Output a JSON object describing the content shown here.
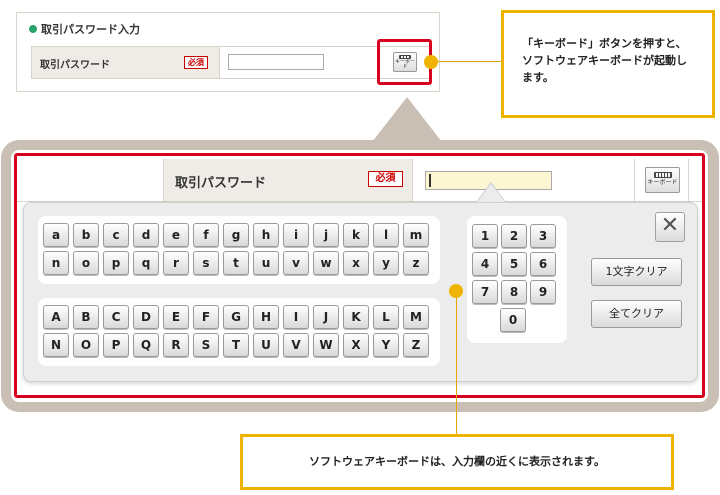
{
  "top_form": {
    "section_title": "取引パスワード入力",
    "field_label": "取引パスワード",
    "required_badge": "必須",
    "keyboard_button_label": "キーボード"
  },
  "callouts": {
    "top": "「キーボード」ボタンを押すと、ソフトウェアキーボードが起動します。",
    "bottom": "ソフトウェアキーボードは、入力欄の近くに表示されます。"
  },
  "enlarged_form": {
    "field_label": "取引パスワード",
    "required_badge": "必須",
    "keyboard_button_label": "キーボード"
  },
  "software_keyboard": {
    "lowercase_keys": [
      "a",
      "b",
      "c",
      "d",
      "e",
      "f",
      "g",
      "h",
      "i",
      "j",
      "k",
      "l",
      "m",
      "n",
      "o",
      "p",
      "q",
      "r",
      "s",
      "t",
      "u",
      "v",
      "w",
      "x",
      "y",
      "z"
    ],
    "uppercase_keys": [
      "A",
      "B",
      "C",
      "D",
      "E",
      "F",
      "G",
      "H",
      "I",
      "J",
      "K",
      "L",
      "M",
      "N",
      "O",
      "P",
      "Q",
      "R",
      "S",
      "T",
      "U",
      "V",
      "W",
      "X",
      "Y",
      "Z"
    ],
    "number_keys": [
      "1",
      "2",
      "3",
      "4",
      "5",
      "6",
      "7",
      "8",
      "9",
      "0"
    ],
    "clear_one_label": "1文字クリア",
    "clear_all_label": "全てクリア",
    "close_glyph": "✕"
  },
  "colors": {
    "highlight_red": "#d7001e",
    "callout_yellow": "#f0b400",
    "frame_beige": "#c9bfb5",
    "label_bg": "#efebe6",
    "input_focus_bg": "#fdf6d2",
    "section_bullet_green": "#2aa36b"
  }
}
